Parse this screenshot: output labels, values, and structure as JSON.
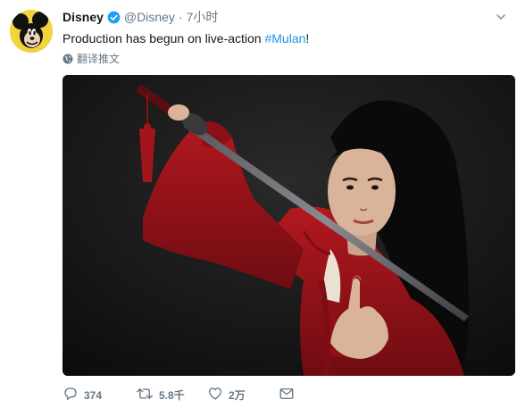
{
  "tweet": {
    "display_name": "Disney",
    "handle": "@Disney",
    "separator": "·",
    "time": "7小时",
    "text_plain": "Production has begun on live-action ",
    "hashtag": "#Mulan",
    "text_suffix": "!",
    "translate_label": "翻译推文",
    "verified": true
  },
  "actions": {
    "reply_count": "374",
    "retweet_count": "5.8千",
    "like_count": "2万"
  },
  "icons": {
    "verified": "verified-badge-icon",
    "caret": "chevron-down-icon",
    "globe": "globe-icon",
    "reply": "reply-icon",
    "retweet": "retweet-icon",
    "like": "heart-icon",
    "message": "envelope-icon"
  },
  "colors": {
    "link": "#1b95e0",
    "muted": "#657786",
    "text": "#14171a",
    "avatar_bg": "#f2d33c",
    "costume_red": "#a3141c"
  }
}
